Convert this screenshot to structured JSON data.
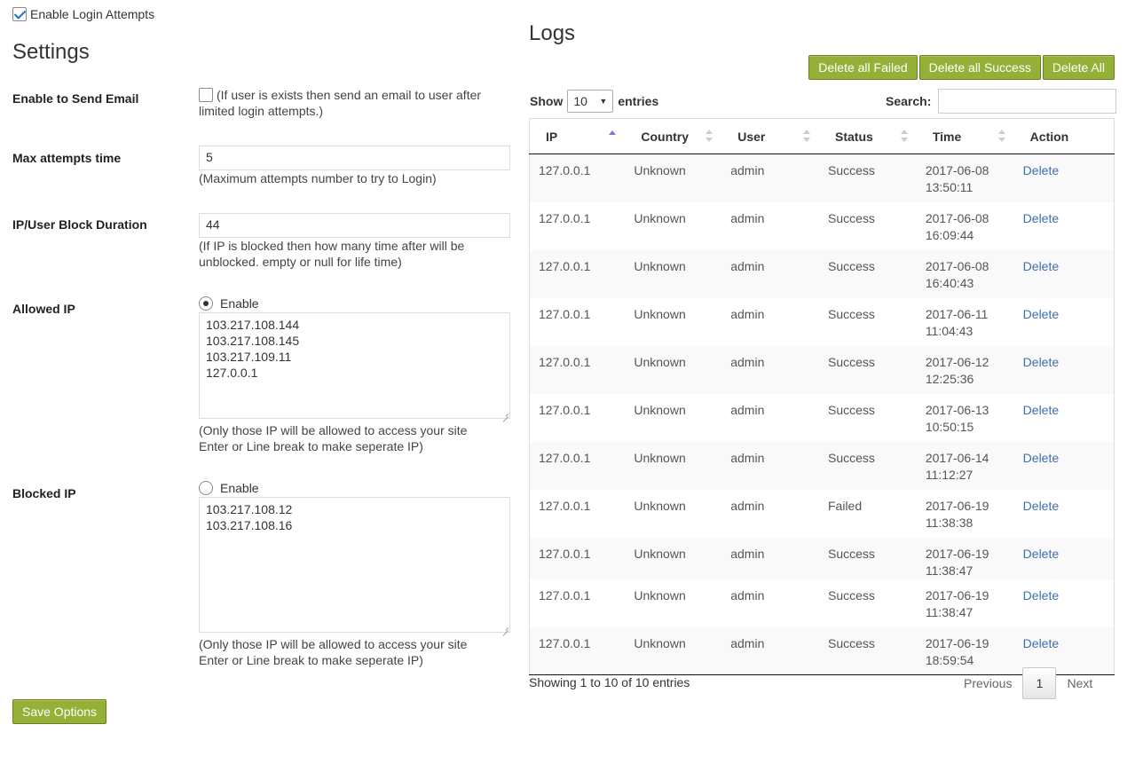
{
  "top": {
    "enable_label": "Enable Login Attempts",
    "enabled": true
  },
  "settings": {
    "title": "Settings",
    "send_email": {
      "label": "Enable to Send Email",
      "checked": false,
      "help": "(If user is exists then send an email to user after limited login attempts.)"
    },
    "max_attempts": {
      "label": "Max attempts time",
      "value": "5",
      "help": "(Maximum attempts number to try to Login)"
    },
    "block_duration": {
      "label": "IP/User Block Duration",
      "value": "44",
      "help": "(If IP is blocked then how many time after will be unblocked. empty or null for life time)"
    },
    "allowed_ip": {
      "label": "Allowed IP",
      "radio_label": "Enable",
      "radio_checked": true,
      "ips": [
        "103.217.108.144",
        "103.217.108.145",
        "103.217.109.11",
        "127.0.0.1"
      ],
      "help_line1": "(Only those IP will be allowed to access your site",
      "help_line2": "Enter or Line break to make seperate IP)"
    },
    "blocked_ip": {
      "label": "Blocked IP",
      "radio_label": "Enable",
      "radio_checked": false,
      "ips": [
        "103.217.108.12",
        "103.217.108.16"
      ],
      "help_line1": "(Only those IP will be allowed to access your site",
      "help_line2": "Enter or Line break to make seperate IP)"
    },
    "save_label": "Save Options"
  },
  "logs": {
    "title": "Logs",
    "buttons": {
      "delete_failed": "Delete all Failed",
      "delete_success": "Delete all Success",
      "delete_all": "Delete All"
    },
    "show_label": "Show",
    "entries_label": "entries",
    "page_size": "10",
    "search_label": "Search:",
    "columns": [
      "IP",
      "Country",
      "User",
      "Status",
      "Time",
      "Action"
    ],
    "rows": [
      {
        "ip": "127.0.0.1",
        "country": "Unknown",
        "user": "admin",
        "status": "Success",
        "date": "2017-06-08",
        "time": "13:50:11",
        "action": "Delete"
      },
      {
        "ip": "127.0.0.1",
        "country": "Unknown",
        "user": "admin",
        "status": "Success",
        "date": "2017-06-08",
        "time": "16:09:44",
        "action": "Delete"
      },
      {
        "ip": "127.0.0.1",
        "country": "Unknown",
        "user": "admin",
        "status": "Success",
        "date": "2017-06-08",
        "time": "16:40:43",
        "action": "Delete"
      },
      {
        "ip": "127.0.0.1",
        "country": "Unknown",
        "user": "admin",
        "status": "Success",
        "date": "2017-06-11",
        "time": "11:04:43",
        "action": "Delete"
      },
      {
        "ip": "127.0.0.1",
        "country": "Unknown",
        "user": "admin",
        "status": "Success",
        "date": "2017-06-12",
        "time": "12:25:36",
        "action": "Delete"
      },
      {
        "ip": "127.0.0.1",
        "country": "Unknown",
        "user": "admin",
        "status": "Success",
        "date": "2017-06-13",
        "time": "10:50:15",
        "action": "Delete"
      },
      {
        "ip": "127.0.0.1",
        "country": "Unknown",
        "user": "admin",
        "status": "Success",
        "date": "2017-06-14",
        "time": "11:12:27",
        "action": "Delete"
      },
      {
        "ip": "127.0.0.1",
        "country": "Unknown",
        "user": "admin",
        "status": "Failed",
        "date": "2017-06-19",
        "time": "11:38:38",
        "action": "Delete"
      },
      {
        "ip": "127.0.0.1",
        "country": "Unknown",
        "user": "admin",
        "status": "Success",
        "date": "2017-06-19",
        "time": "11:38:47",
        "action": "Delete"
      },
      {
        "ip": "127.0.0.1",
        "country": "Unknown",
        "user": "admin",
        "status": "Success",
        "date": "2017-06-19",
        "time": "11:38:47",
        "action": "Delete"
      },
      {
        "ip": "127.0.0.1",
        "country": "Unknown",
        "user": "admin",
        "status": "Success",
        "date": "2017-06-19",
        "time": "18:59:54",
        "action": "Delete"
      }
    ],
    "info": "Showing 1 to 10 of 10 entries",
    "pager": {
      "previous": "Previous",
      "current": "1",
      "next": "Next"
    }
  },
  "colors": {
    "button_green": "#95b036",
    "success": "#2b8a1e",
    "failed": "#d9262a",
    "link": "#3e6fb0"
  }
}
